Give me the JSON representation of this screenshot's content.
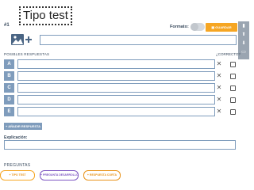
{
  "title": "Tipo test",
  "question": {
    "number": "#1",
    "input_value": ""
  },
  "format": {
    "label": "Formato:",
    "enabled": false
  },
  "save_button": {
    "label": "GUARDAR",
    "icon": "save-icon"
  },
  "side_rail": {
    "buttons": [
      {
        "icon": "trash-icon"
      },
      {
        "icon": "arrow-up-icon"
      },
      {
        "icon": "arrow-down-icon"
      },
      {
        "icon": "copy-icon"
      }
    ]
  },
  "answers": {
    "header_left": "POSIBLES RESPUESTAS",
    "header_right": "¿CORRECTO?",
    "items": [
      {
        "letter": "A",
        "value": "",
        "correct": false
      },
      {
        "letter": "B",
        "value": "",
        "correct": false
      },
      {
        "letter": "C",
        "value": "",
        "correct": false
      },
      {
        "letter": "D",
        "value": "",
        "correct": false
      },
      {
        "letter": "E",
        "value": "",
        "correct": false
      }
    ],
    "remove_symbol": "✕"
  },
  "add_answer_button": "+ AÑADIR RESPUESTA",
  "explanation": {
    "label": "Explicación:",
    "value": ""
  },
  "questions_section": {
    "label": "PREGUNTAS",
    "buttons": [
      {
        "label": "+  TIPO TEST",
        "color": "#f6a623"
      },
      {
        "label": "+  PREGUNTA DESARROLLO",
        "color": "#7e57c2"
      },
      {
        "label": "+  RESPUESTA CORTA",
        "color": "#e8931a"
      }
    ]
  },
  "colors": {
    "accent": "#f6a623",
    "field_border": "#7f9cbc",
    "rail": "#9aa5b1",
    "purple": "#7e57c2"
  }
}
